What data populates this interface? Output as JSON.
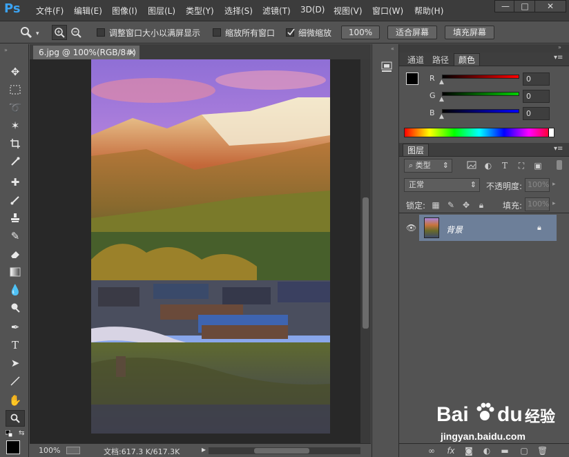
{
  "app": {
    "logo": "Ps"
  },
  "menu": [
    "文件(F)",
    "编辑(E)",
    "图像(I)",
    "图层(L)",
    "类型(Y)",
    "选择(S)",
    "滤镜(T)",
    "3D(D)",
    "视图(V)",
    "窗口(W)",
    "帮助(H)"
  ],
  "window_controls": {
    "minimize": "—",
    "maximize": "□",
    "close": "✕"
  },
  "options": {
    "resize_windows_label": "调整窗口大小以满屏显示",
    "zoom_all_label": "缩放所有窗口",
    "scrubby_zoom_label": "细微缩放",
    "zoom_100_button": "100%",
    "fit_screen_button": "适合屏幕",
    "fill_screen_button": "填充屏幕"
  },
  "document": {
    "tab_title": "6.jpg @ 100%(RGB/8#)",
    "tab_close": "×",
    "zoom": "100%",
    "doc_info": "文档:617.3 K/617.3K"
  },
  "panels": {
    "tabs": [
      "通道",
      "路径",
      "颜色"
    ],
    "color": {
      "r_label": "R",
      "g_label": "G",
      "b_label": "B",
      "r_value": "0",
      "g_value": "0",
      "b_value": "0"
    },
    "layers": {
      "tab": "图层",
      "filter_type": "类型",
      "blend_mode": "正常",
      "opacity_label": "不透明度:",
      "opacity_value": "100%",
      "lock_label": "锁定:",
      "fill_label": "填充:",
      "fill_value": "100%",
      "layer_name": "背景"
    }
  },
  "watermark": {
    "line1": "Bai",
    "line2": "du",
    "brand_suffix": "经验",
    "url": "jingyan.baidu.com"
  },
  "colors": {
    "accent": "#3ba3f2",
    "layer_selected": "#6d7f99"
  }
}
